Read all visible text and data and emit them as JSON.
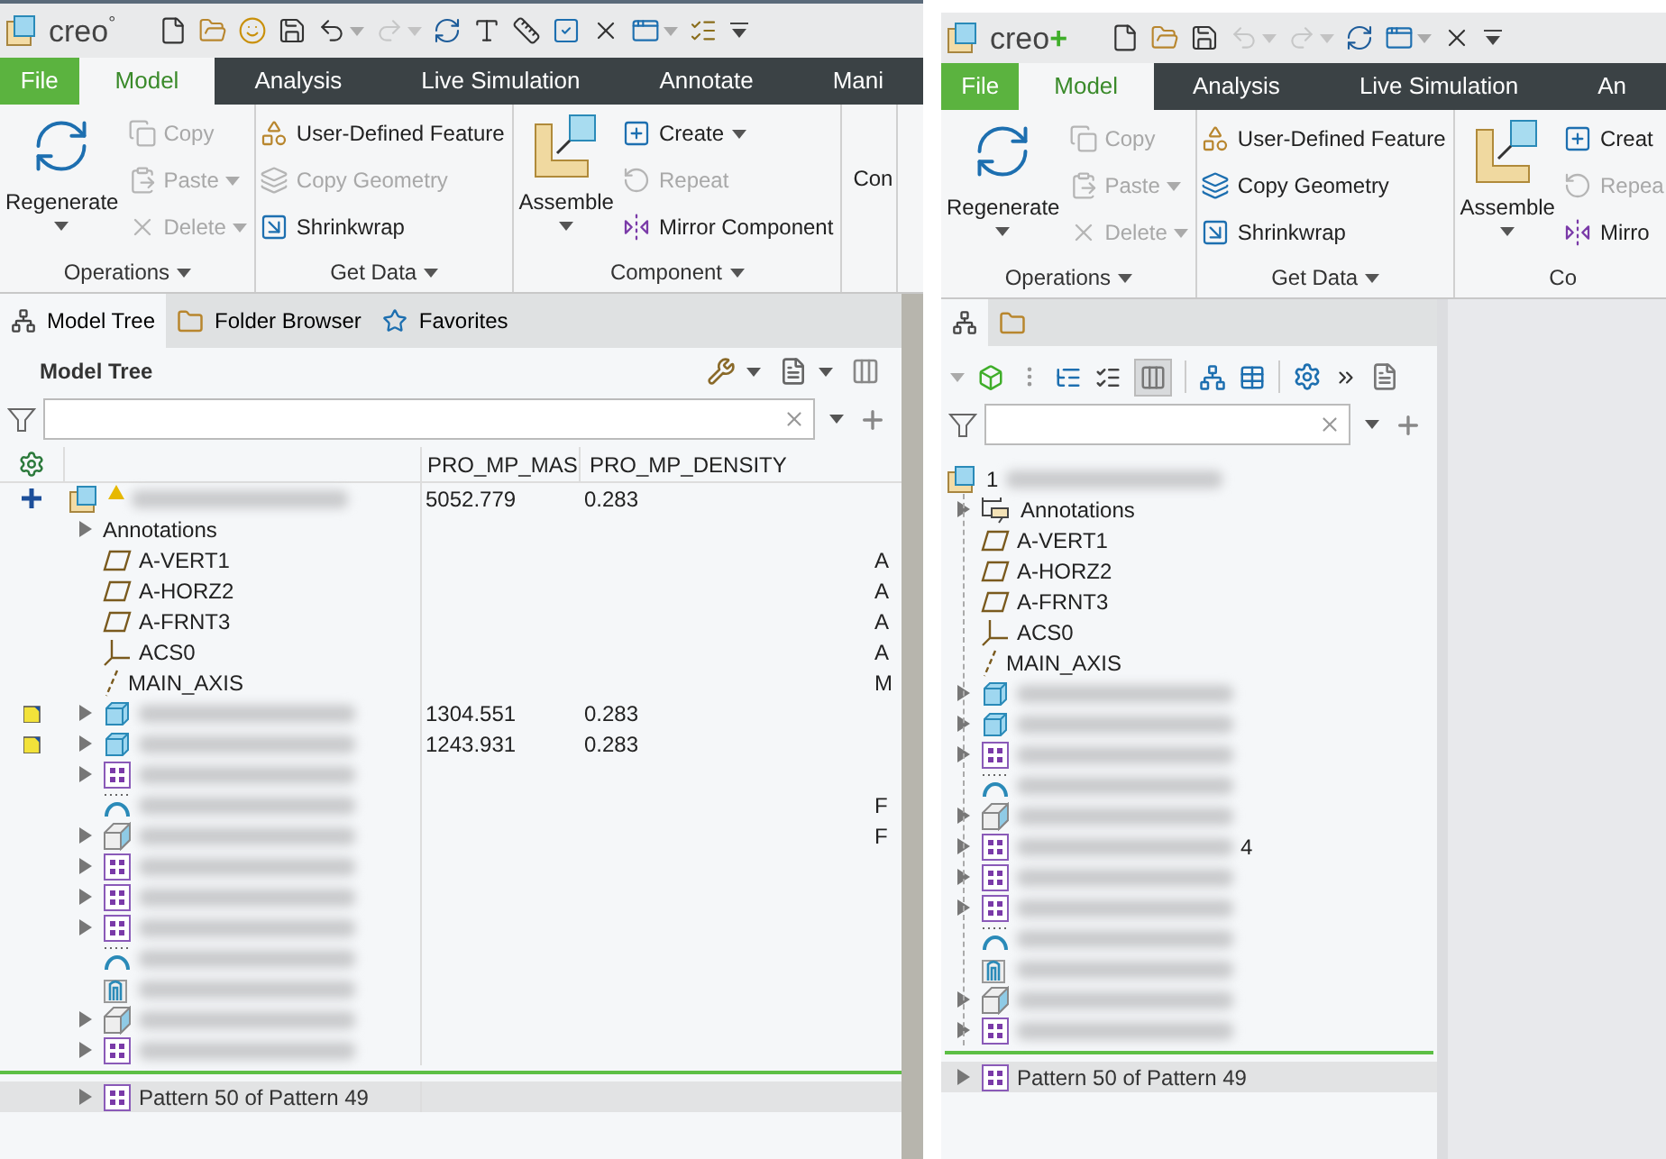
{
  "left": {
    "logo": "creo",
    "logo_suffix": "°",
    "quick_access": [
      {
        "caret": false,
        "disabled": false
      },
      {
        "caret": false,
        "disabled": false
      },
      {
        "caret": false,
        "disabled": false
      },
      {
        "caret": false,
        "disabled": false
      },
      {
        "caret": true,
        "disabled": false
      },
      {
        "caret": true,
        "disabled": true
      },
      {
        "caret": false,
        "disabled": false
      },
      {
        "caret": false,
        "disabled": false
      },
      {
        "caret": false,
        "disabled": false
      },
      {
        "caret": false,
        "disabled": false
      },
      {
        "caret": false,
        "disabled": false
      },
      {
        "caret": true,
        "disabled": false
      },
      {
        "caret": false,
        "disabled": false
      },
      {
        "caret": false,
        "disabled": false
      }
    ],
    "tabs": [
      {
        "label": "File",
        "kind": "file",
        "selected": false
      },
      {
        "label": "Model",
        "kind": "tab",
        "selected": true
      },
      {
        "label": "Analysis",
        "kind": "tab",
        "selected": false
      },
      {
        "label": "Live Simulation",
        "kind": "tab",
        "selected": false
      },
      {
        "label": "Annotate",
        "kind": "tab",
        "selected": false
      },
      {
        "label": "Mani",
        "kind": "tab",
        "selected": false
      }
    ],
    "ribbon": [
      {
        "title": "Operations",
        "caret": true,
        "columns": [
          [
            {
              "label": "Regenerate",
              "kind": "large",
              "caret": true,
              "disabled": false
            }
          ],
          [
            {
              "label": "Copy",
              "kind": "small",
              "caret": false,
              "disabled": true
            },
            {
              "label": "Paste",
              "kind": "small",
              "caret": true,
              "disabled": true
            },
            {
              "label": "Delete",
              "kind": "small",
              "caret": true,
              "disabled": true
            }
          ]
        ]
      },
      {
        "title": "Get Data",
        "caret": true,
        "columns": [
          [
            {
              "label": "User-Defined Feature",
              "kind": "small",
              "caret": false,
              "disabled": false
            },
            {
              "label": "Copy Geometry",
              "kind": "small",
              "caret": false,
              "disabled": true
            },
            {
              "label": "Shrinkwrap",
              "kind": "small",
              "caret": false,
              "disabled": false
            }
          ]
        ]
      },
      {
        "title": "Component",
        "caret": true,
        "columns": [
          [
            {
              "label": "Assemble",
              "kind": "large",
              "caret": true,
              "disabled": false
            }
          ],
          [
            {
              "label": "Create",
              "kind": "small",
              "caret": true,
              "disabled": false
            },
            {
              "label": "Repeat",
              "kind": "small",
              "caret": false,
              "disabled": true
            },
            {
              "label": "Mirror Component",
              "kind": "small",
              "caret": false,
              "disabled": false
            }
          ]
        ]
      },
      {
        "columns": [
          [
            {
              "label": "Con",
              "kind": "middle",
              "caret": false,
              "disabled": false
            }
          ]
        ]
      }
    ],
    "panel_tabs": [
      {
        "label": "Model Tree",
        "kind": "tree",
        "selected": true
      },
      {
        "label": "Folder Browser",
        "kind": "folder",
        "selected": false
      },
      {
        "label": "Favorites",
        "kind": "favorites",
        "selected": false
      }
    ],
    "tree_title": "Model Tree",
    "columns": [
      "PRO_MP_MAS",
      "PRO_MP_DENSITY"
    ],
    "tree": {
      "kind": "assembly",
      "plus_marker": true,
      "warning": true,
      "redacted": true,
      "mass": "5052.779",
      "density": "0.283",
      "children": [
        {
          "label": "Annotations",
          "expandable": true
        },
        {
          "kind": "plane",
          "label": "A-VERT1",
          "column_3": "A"
        },
        {
          "kind": "plane",
          "label": "A-HORZ2",
          "column_3": "A"
        },
        {
          "kind": "plane",
          "label": "A-FRNT3",
          "column_3": "A"
        },
        {
          "kind": "csys",
          "label": "ACS0",
          "column_3": "A"
        },
        {
          "kind": "axis",
          "label": "MAIN_AXIS",
          "column_3": "M"
        },
        {
          "kind": "part",
          "note_marker": true,
          "expandable": true,
          "redacted": true,
          "mass": "1304.551",
          "density": "0.283"
        },
        {
          "kind": "part",
          "note_marker": true,
          "expandable": true,
          "redacted": true,
          "mass": "1243.931",
          "density": "0.283"
        },
        {
          "kind": "pattern",
          "expandable": true,
          "redacted": true
        },
        {
          "kind": "curve",
          "redacted": true,
          "column_3": "F"
        },
        {
          "kind": "solid",
          "expandable": true,
          "redacted": true,
          "column_3": "F"
        },
        {
          "kind": "pattern",
          "expandable": true,
          "redacted": true
        },
        {
          "kind": "pattern",
          "expandable": true,
          "redacted": true
        },
        {
          "kind": "pattern",
          "expandable": true,
          "redacted": true
        },
        {
          "kind": "curve",
          "redacted": true
        },
        {
          "kind": "flex",
          "redacted": true
        },
        {
          "kind": "solid",
          "expandable": true,
          "redacted": true
        },
        {
          "kind": "pattern",
          "expandable": true,
          "redacted": true
        }
      ]
    },
    "insert_row": {
      "kind": "pattern",
      "label": "Pattern 50 of Pattern 49",
      "expandable": true
    }
  },
  "right": {
    "logo": "creo",
    "logo_suffix": "+",
    "quick_access": [
      {
        "caret": false,
        "disabled": false
      },
      {
        "caret": false,
        "disabled": false
      },
      {
        "caret": false,
        "disabled": false
      },
      {
        "caret": true,
        "disabled": true
      },
      {
        "caret": true,
        "disabled": true
      },
      {
        "caret": false,
        "disabled": false
      },
      {
        "caret": true,
        "disabled": false
      },
      {
        "caret": false,
        "disabled": false
      },
      {
        "caret": false,
        "disabled": false
      }
    ],
    "tabs": [
      {
        "label": "File",
        "kind": "file",
        "selected": false
      },
      {
        "label": "Model",
        "kind": "tab",
        "selected": true
      },
      {
        "label": "Analysis",
        "kind": "tab",
        "selected": false
      },
      {
        "label": "Live Simulation",
        "kind": "tab",
        "selected": false
      },
      {
        "label": "An",
        "kind": "tab",
        "selected": false
      }
    ],
    "ribbon": [
      {
        "title": "Operations",
        "caret": true,
        "columns": [
          [
            {
              "label": "Regenerate",
              "kind": "large",
              "caret": true,
              "disabled": false
            }
          ],
          [
            {
              "label": "Copy",
              "kind": "small",
              "caret": false,
              "disabled": true
            },
            {
              "label": "Paste",
              "kind": "small",
              "caret": true,
              "disabled": true
            },
            {
              "label": "Delete",
              "kind": "small",
              "caret": true,
              "disabled": true
            }
          ]
        ]
      },
      {
        "title": "Get Data",
        "caret": true,
        "columns": [
          [
            {
              "label": "User-Defined Feature",
              "kind": "small",
              "caret": false,
              "disabled": false
            },
            {
              "label": "Copy Geometry",
              "kind": "small",
              "caret": false,
              "disabled": false
            },
            {
              "label": "Shrinkwrap",
              "kind": "small",
              "caret": false,
              "disabled": false
            }
          ]
        ]
      },
      {
        "title": "Co",
        "caret": false,
        "columns": [
          [
            {
              "label": "Assemble",
              "kind": "large",
              "caret": true,
              "disabled": false
            }
          ],
          [
            {
              "label": "Creat",
              "kind": "small",
              "caret": false,
              "disabled": false
            },
            {
              "label": "Repea",
              "kind": "small",
              "caret": false,
              "disabled": true
            },
            {
              "label": "Mirro",
              "kind": "small",
              "caret": false,
              "disabled": false
            }
          ]
        ]
      }
    ],
    "panel_tabs": [
      {
        "kind": "tree",
        "selected": true
      },
      {
        "kind": "folder",
        "selected": false
      }
    ],
    "tree": {
      "kind": "assembly",
      "label": "1",
      "redacted": true,
      "children": [
        {
          "kind": "annotation",
          "label": "Annotations",
          "expandable": true
        },
        {
          "kind": "plane",
          "label": "A-VERT1"
        },
        {
          "kind": "plane",
          "label": "A-HORZ2"
        },
        {
          "kind": "plane",
          "label": "A-FRNT3"
        },
        {
          "kind": "csys",
          "label": "ACS0"
        },
        {
          "kind": "axis",
          "label": "MAIN_AXIS"
        },
        {
          "kind": "part",
          "expandable": true,
          "redacted": true
        },
        {
          "kind": "part",
          "expandable": true,
          "redacted": true
        },
        {
          "kind": "pattern",
          "expandable": true,
          "redacted": true
        },
        {
          "kind": "curve",
          "redacted": true
        },
        {
          "kind": "solid",
          "expandable": true,
          "redacted": true
        },
        {
          "kind": "pattern",
          "expandable": true,
          "redacted": true,
          "suffix": "4"
        },
        {
          "kind": "pattern",
          "expandable": true,
          "redacted": true
        },
        {
          "kind": "pattern",
          "expandable": true,
          "redacted": true
        },
        {
          "kind": "curve",
          "redacted": true
        },
        {
          "kind": "flex",
          "redacted": true
        },
        {
          "kind": "solid",
          "expandable": true,
          "redacted": true
        },
        {
          "kind": "pattern",
          "expandable": true,
          "redacted": true
        }
      ]
    },
    "insert_row": {
      "kind": "pattern",
      "label": "Pattern 50 of Pattern 49",
      "expandable": true
    }
  }
}
